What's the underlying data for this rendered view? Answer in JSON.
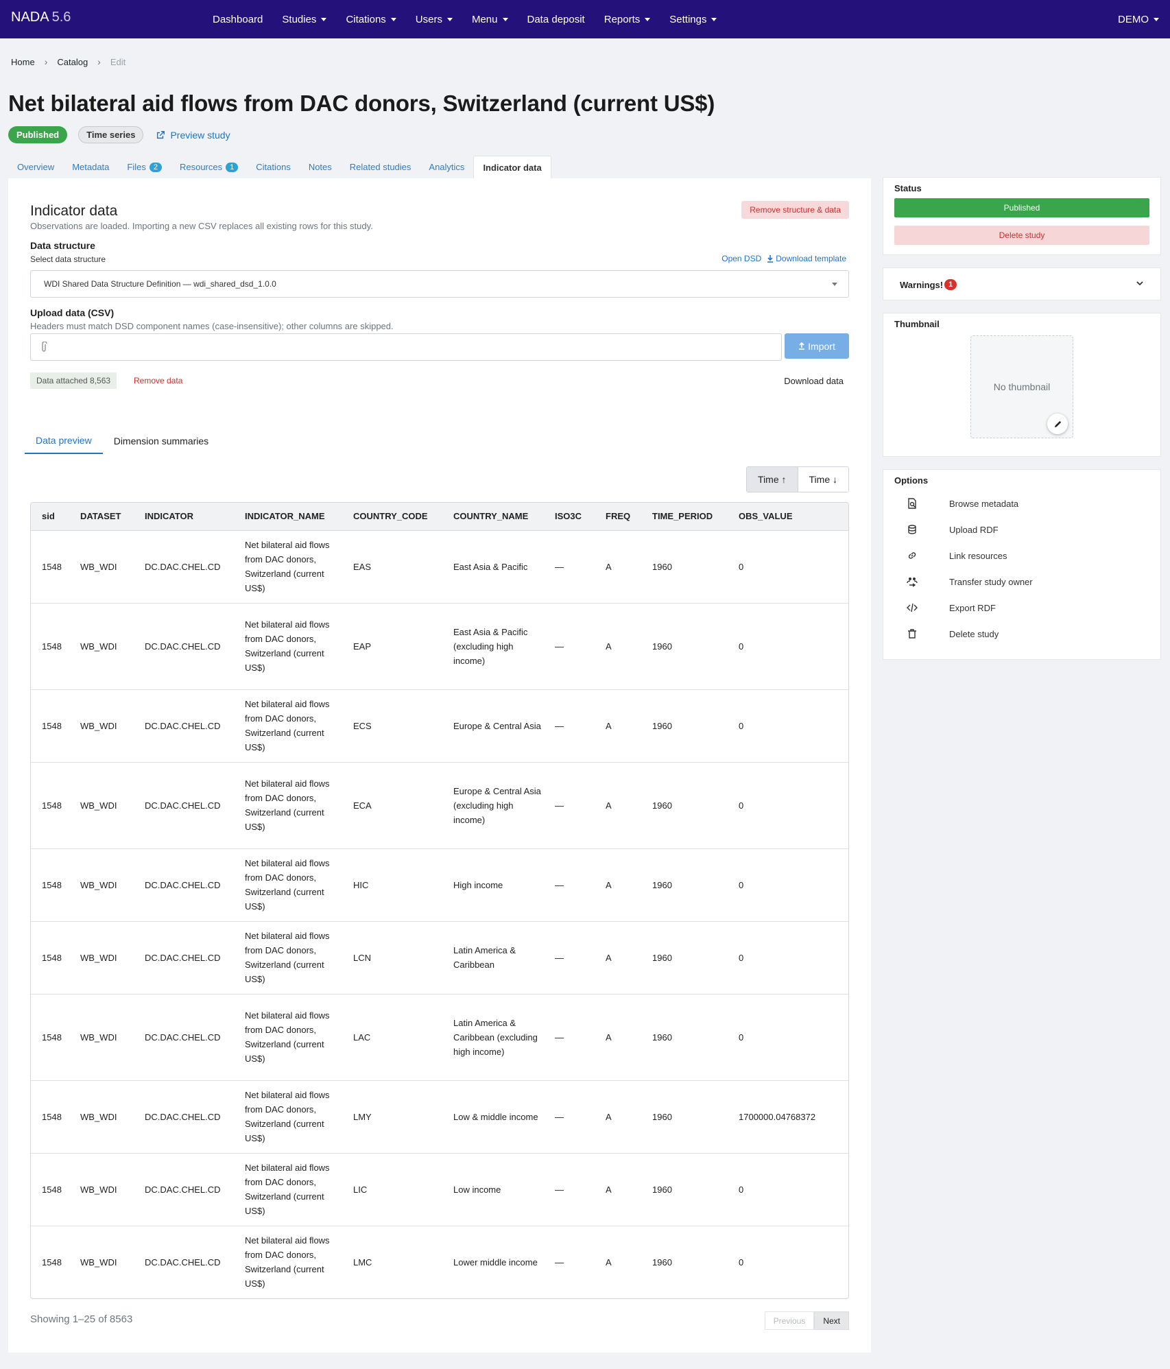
{
  "navbar": {
    "brand": "NADA",
    "version": "5.6",
    "items": [
      {
        "label": "Dashboard",
        "dropdown": false
      },
      {
        "label": "Studies",
        "dropdown": true
      },
      {
        "label": "Citations",
        "dropdown": true
      },
      {
        "label": "Users",
        "dropdown": true
      },
      {
        "label": "Menu",
        "dropdown": true
      },
      {
        "label": "Data deposit",
        "dropdown": false
      },
      {
        "label": "Reports",
        "dropdown": true
      },
      {
        "label": "Settings",
        "dropdown": true
      }
    ],
    "user": "DEMO"
  },
  "breadcrumb": {
    "home": "Home",
    "catalog": "Catalog",
    "current": "Edit"
  },
  "page": {
    "title": "Net bilateral aid flows from DAC donors, Switzerland (current US$)",
    "status_badge": "Published",
    "type_badge": "Time series",
    "preview_link": "Preview study"
  },
  "tabs": [
    {
      "label": "Overview",
      "count": null
    },
    {
      "label": "Metadata",
      "count": null
    },
    {
      "label": "Files",
      "count": "2"
    },
    {
      "label": "Resources",
      "count": "1"
    },
    {
      "label": "Citations",
      "count": null
    },
    {
      "label": "Notes",
      "count": null
    },
    {
      "label": "Related studies",
      "count": null
    },
    {
      "label": "Analytics",
      "count": null
    },
    {
      "label": "Indicator data",
      "count": null,
      "active": true
    }
  ],
  "indicator": {
    "heading": "Indicator data",
    "subtitle": "Observations are loaded. Importing a new CSV replaces all existing rows for this study.",
    "remove_structure_label": "Remove structure & data",
    "data_structure_label": "Data structure",
    "select_label": "Select data structure",
    "open_dsd": "Open DSD",
    "download_template": "Download template",
    "selected_dsd": "WDI Shared Data Structure Definition — wdi_shared_dsd_1.0.0",
    "upload_label": "Upload data (CSV)",
    "upload_help": "Headers must match DSD component names (case-insensitive); other columns are skipped.",
    "import_label": "Import",
    "data_attached": "Data attached 8,563",
    "remove_data": "Remove data",
    "download_data": "Download data"
  },
  "subtabs": {
    "preview": "Data preview",
    "summaries": "Dimension summaries"
  },
  "sort": {
    "asc": "Time ↑",
    "desc": "Time ↓"
  },
  "table": {
    "columns": [
      "sid",
      "DATASET",
      "INDICATOR",
      "INDICATOR_NAME",
      "COUNTRY_CODE",
      "COUNTRY_NAME",
      "ISO3C",
      "FREQ",
      "TIME_PERIOD",
      "OBS_VALUE"
    ],
    "rows": [
      [
        "1548",
        "WB_WDI",
        "DC.DAC.CHEL.CD",
        "Net bilateral aid flows from DAC donors, Switzerland (current US$)",
        "EAS",
        "East Asia & Pacific",
        "—",
        "A",
        "1960",
        "0"
      ],
      [
        "1548",
        "WB_WDI",
        "DC.DAC.CHEL.CD",
        "Net bilateral aid flows from DAC donors, Switzerland (current US$)",
        "EAP",
        "East Asia & Pacific (excluding high income)",
        "—",
        "A",
        "1960",
        "0"
      ],
      [
        "1548",
        "WB_WDI",
        "DC.DAC.CHEL.CD",
        "Net bilateral aid flows from DAC donors, Switzerland (current US$)",
        "ECS",
        "Europe & Central Asia",
        "—",
        "A",
        "1960",
        "0"
      ],
      [
        "1548",
        "WB_WDI",
        "DC.DAC.CHEL.CD",
        "Net bilateral aid flows from DAC donors, Switzerland (current US$)",
        "ECA",
        "Europe & Central Asia (excluding high income)",
        "—",
        "A",
        "1960",
        "0"
      ],
      [
        "1548",
        "WB_WDI",
        "DC.DAC.CHEL.CD",
        "Net bilateral aid flows from DAC donors, Switzerland (current US$)",
        "HIC",
        "High income",
        "—",
        "A",
        "1960",
        "0"
      ],
      [
        "1548",
        "WB_WDI",
        "DC.DAC.CHEL.CD",
        "Net bilateral aid flows from DAC donors, Switzerland (current US$)",
        "LCN",
        "Latin America & Caribbean",
        "—",
        "A",
        "1960",
        "0"
      ],
      [
        "1548",
        "WB_WDI",
        "DC.DAC.CHEL.CD",
        "Net bilateral aid flows from DAC donors, Switzerland (current US$)",
        "LAC",
        "Latin America & Caribbean (excluding high income)",
        "—",
        "A",
        "1960",
        "0"
      ],
      [
        "1548",
        "WB_WDI",
        "DC.DAC.CHEL.CD",
        "Net bilateral aid flows from DAC donors, Switzerland (current US$)",
        "LMY",
        "Low & middle income",
        "—",
        "A",
        "1960",
        "1700000.04768372"
      ],
      [
        "1548",
        "WB_WDI",
        "DC.DAC.CHEL.CD",
        "Net bilateral aid flows from DAC donors, Switzerland (current US$)",
        "LIC",
        "Low income",
        "—",
        "A",
        "1960",
        "0"
      ],
      [
        "1548",
        "WB_WDI",
        "DC.DAC.CHEL.CD",
        "Net bilateral aid flows from DAC donors, Switzerland (current US$)",
        "LMC",
        "Lower middle income",
        "—",
        "A",
        "1960",
        "0"
      ]
    ]
  },
  "pagination": {
    "showing": "Showing 1–25 of 8563",
    "previous": "Previous",
    "next": "Next"
  },
  "sidebar": {
    "status_label": "Status",
    "published_button": "Published",
    "delete_button": "Delete study",
    "warnings_label": "Warnings!",
    "warnings_count": "1",
    "thumbnail_label": "Thumbnail",
    "no_thumbnail": "No thumbnail",
    "options_label": "Options",
    "options": [
      {
        "label": "Browse metadata",
        "icon": "browse-metadata-icon"
      },
      {
        "label": "Upload RDF",
        "icon": "upload-rdf-icon"
      },
      {
        "label": "Link resources",
        "icon": "link-icon"
      },
      {
        "label": "Transfer study owner",
        "icon": "transfer-owner-icon"
      },
      {
        "label": "Export RDF",
        "icon": "code-icon"
      },
      {
        "label": "Delete study",
        "icon": "trash-icon"
      }
    ]
  },
  "colors": {
    "navbar": "#24127a",
    "accent": "#1f74c7",
    "success": "#3aa54a",
    "danger": "#c9302c"
  }
}
